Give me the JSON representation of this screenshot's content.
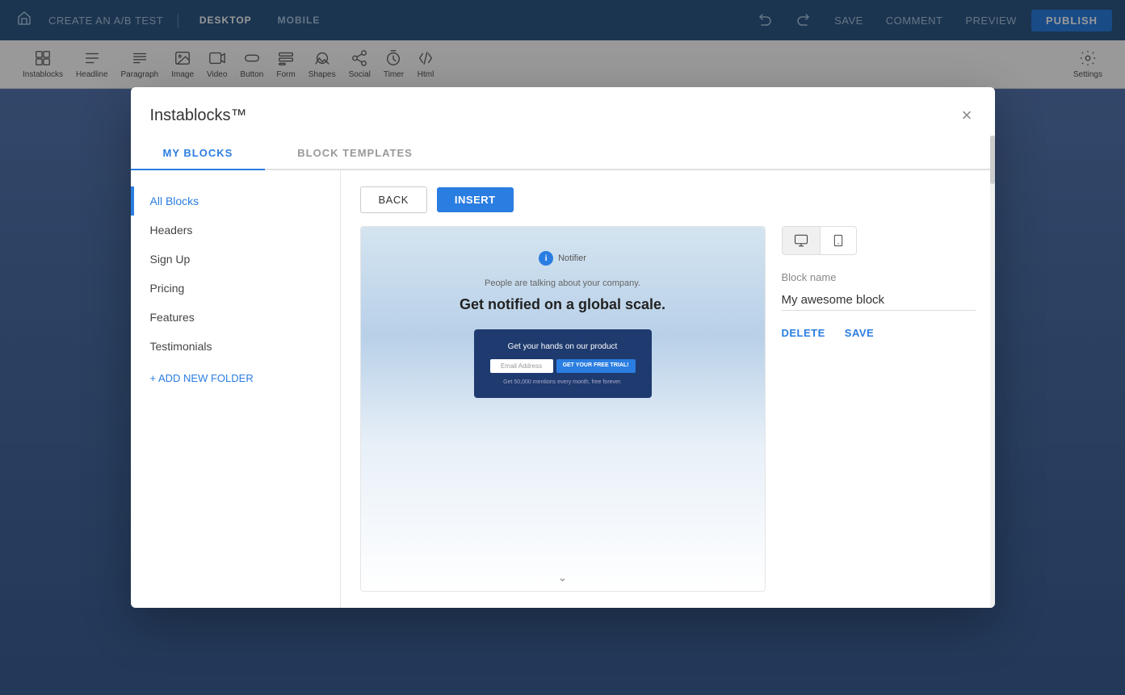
{
  "topbar": {
    "create_ab_test": "CREATE AN A/B TEST",
    "desktop": "DESKTOP",
    "mobile": "MOBILE",
    "save": "SAVE",
    "comment": "COMMENT",
    "preview": "PREVIEW",
    "publish": "PUBLISH"
  },
  "second_toolbar": {
    "tools": [
      {
        "name": "Instablocks",
        "icon": "instablocks"
      },
      {
        "name": "Headline",
        "icon": "headline"
      },
      {
        "name": "Paragraph",
        "icon": "paragraph"
      },
      {
        "name": "Image",
        "icon": "image"
      },
      {
        "name": "Video",
        "icon": "video"
      },
      {
        "name": "Button",
        "icon": "button"
      },
      {
        "name": "Form",
        "icon": "form"
      },
      {
        "name": "Shapes",
        "icon": "shapes"
      },
      {
        "name": "Social",
        "icon": "social"
      },
      {
        "name": "Timer",
        "icon": "timer"
      },
      {
        "name": "Html",
        "icon": "html"
      },
      {
        "name": "Settings",
        "icon": "settings"
      }
    ]
  },
  "modal": {
    "title": "Instablocks™",
    "close_label": "×",
    "tabs": [
      {
        "label": "MY BLOCKS",
        "active": true
      },
      {
        "label": "BLOCK TEMPLATES",
        "active": false
      }
    ],
    "sidebar": {
      "items": [
        {
          "label": "All Blocks",
          "active": true
        },
        {
          "label": "Headers",
          "active": false
        },
        {
          "label": "Sign Up",
          "active": false
        },
        {
          "label": "Pricing",
          "active": false
        },
        {
          "label": "Features",
          "active": false
        },
        {
          "label": "Testimonials",
          "active": false
        }
      ],
      "add_folder": "+ ADD NEW FOLDER"
    },
    "actions": {
      "back_label": "BACK",
      "insert_label": "INSERT"
    },
    "preview": {
      "notifier_icon": "i",
      "notifier_text": "Notifier",
      "subtitle": "People are talking about your company.",
      "headline": "Get notified on a global scale.",
      "cta_title": "Get your hands on our product",
      "email_placeholder": "Email Address",
      "cta_button": "GET YOUR FREE TRIAL!",
      "fine_print": "Get 50,000 mentions every month, free forever.",
      "chevron": "⌄"
    },
    "right_panel": {
      "desktop_icon": "🖥",
      "mobile_icon": "📱",
      "block_name_label": "Block name",
      "block_name_value": "My awesome block",
      "delete_label": "DELETE",
      "save_label": "SAVE"
    }
  }
}
